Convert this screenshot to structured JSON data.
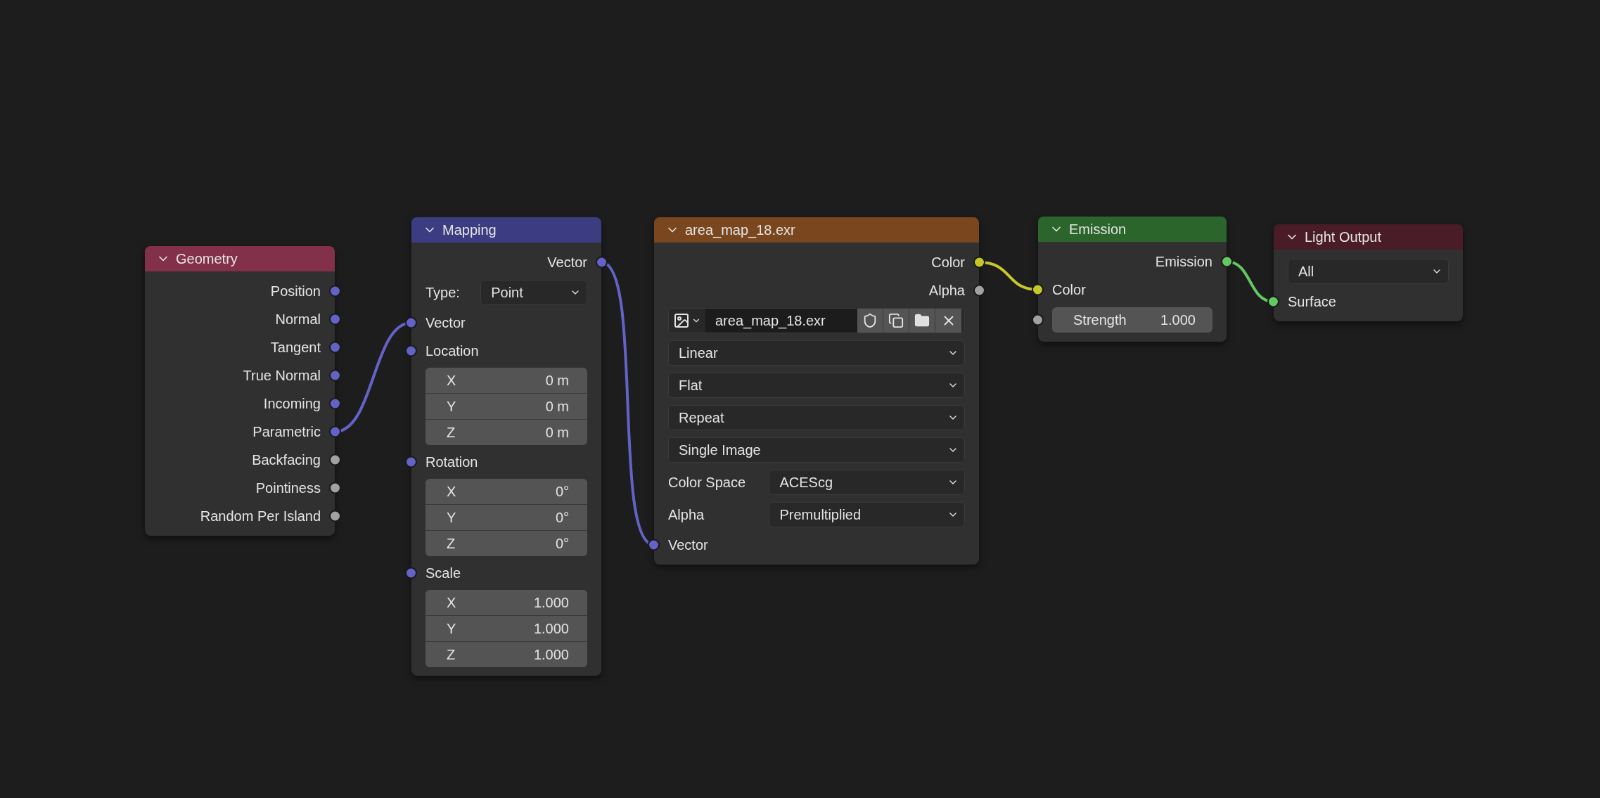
{
  "nodes": [
    {
      "title": "Geometry",
      "color": "#83314a",
      "rows": [
        {
          "kind": "output",
          "label": "Position",
          "color": "#6363c7"
        },
        {
          "kind": "output",
          "label": "Normal",
          "color": "#6363c7"
        },
        {
          "kind": "output",
          "label": "Tangent",
          "color": "#6363c7"
        },
        {
          "kind": "output",
          "label": "True Normal",
          "color": "#6363c7"
        },
        {
          "kind": "output",
          "label": "Incoming",
          "color": "#6363c7"
        },
        {
          "kind": "output",
          "label": "Parametric",
          "color": "#6363c7"
        },
        {
          "kind": "output",
          "label": "Backfacing",
          "color": "#a1a1a1"
        },
        {
          "kind": "output",
          "label": "Pointiness",
          "color": "#a1a1a1"
        },
        {
          "kind": "output",
          "label": "Random Per Island",
          "color": "#a1a1a1"
        }
      ]
    },
    {
      "title": "Mapping",
      "color": "#3c3c83",
      "rows": [
        {
          "kind": "output",
          "label": "Vector",
          "color": "#6363c7"
        },
        {
          "kind": "labeled_dropdown",
          "label": "Type:",
          "value": "Point"
        },
        {
          "kind": "input",
          "label": "Vector",
          "color": "#6363c7"
        },
        {
          "kind": "input",
          "label": "Location",
          "color": "#6363c7"
        },
        {
          "kind": "vector_fields",
          "fields": [
            {
              "axis": "X",
              "value": "0 m"
            },
            {
              "axis": "Y",
              "value": "0 m"
            },
            {
              "axis": "Z",
              "value": "0 m"
            }
          ]
        },
        {
          "kind": "input",
          "label": "Rotation",
          "color": "#6363c7"
        },
        {
          "kind": "vector_fields",
          "fields": [
            {
              "axis": "X",
              "value": "0°"
            },
            {
              "axis": "Y",
              "value": "0°"
            },
            {
              "axis": "Z",
              "value": "0°"
            }
          ]
        },
        {
          "kind": "input",
          "label": "Scale",
          "color": "#6363c7"
        },
        {
          "kind": "vector_fields",
          "fields": [
            {
              "axis": "X",
              "value": "1.000"
            },
            {
              "axis": "Y",
              "value": "1.000"
            },
            {
              "axis": "Z",
              "value": "1.000"
            }
          ]
        }
      ]
    },
    {
      "title": "area_map_18.exr",
      "color": "#79461d",
      "rows": [
        {
          "kind": "output",
          "label": "Color",
          "color": "#c7c729"
        },
        {
          "kind": "output",
          "label": "Alpha",
          "color": "#a1a1a1"
        },
        {
          "kind": "image_picker",
          "filename": "area_map_18.exr"
        },
        {
          "kind": "dropdown",
          "value": "Linear"
        },
        {
          "kind": "dropdown",
          "value": "Flat"
        },
        {
          "kind": "dropdown",
          "value": "Repeat"
        },
        {
          "kind": "dropdown",
          "value": "Single Image"
        },
        {
          "kind": "labeled_dropdown",
          "label": "Color Space",
          "value": "ACEScg"
        },
        {
          "kind": "labeled_dropdown",
          "label": "Alpha",
          "value": "Premultiplied"
        },
        {
          "kind": "input",
          "label": "Vector",
          "color": "#6363c7"
        }
      ]
    },
    {
      "title": "Emission",
      "color": "#2b652b",
      "rows": [
        {
          "kind": "output",
          "label": "Emission",
          "color": "#63c763"
        },
        {
          "kind": "input",
          "label": "Color",
          "color": "#c7c729"
        },
        {
          "kind": "value_field",
          "label": "Strength",
          "value": "1.000",
          "color": "#a1a1a1"
        }
      ]
    },
    {
      "title": "Light Output",
      "color": "#4a1c27",
      "rows": [
        {
          "kind": "dropdown",
          "value": "All"
        },
        {
          "kind": "input",
          "label": "Surface",
          "color": "#63c763"
        }
      ]
    }
  ]
}
